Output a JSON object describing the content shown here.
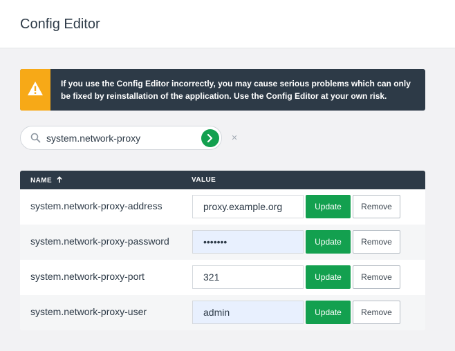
{
  "header": {
    "title": "Config Editor"
  },
  "warning": {
    "icon": "warning-icon",
    "accent_color": "#f7a917",
    "text": "If you use the Config Editor incorrectly, you may cause serious problems which can only be fixed by reinstallation of the application. Use the Config Editor at your own risk."
  },
  "search": {
    "value": "system.network-proxy",
    "go_icon": "chevron-right-icon",
    "clear_label": "×"
  },
  "table": {
    "columns": {
      "name": "NAME",
      "value": "VALUE"
    },
    "sort": {
      "column": "name",
      "direction": "ascending"
    },
    "rows": [
      {
        "name": "system.network-proxy-address",
        "value": "proxy.example.org",
        "autofilled": false,
        "update_label": "Update",
        "remove_label": "Remove"
      },
      {
        "name": "system.network-proxy-password",
        "value": "•••••••",
        "autofilled": true,
        "update_label": "Update",
        "remove_label": "Remove"
      },
      {
        "name": "system.network-proxy-port",
        "value": "321",
        "autofilled": false,
        "update_label": "Update",
        "remove_label": "Remove"
      },
      {
        "name": "system.network-proxy-user",
        "value": "admin",
        "autofilled": true,
        "update_label": "Update",
        "remove_label": "Remove"
      }
    ]
  },
  "colors": {
    "primary_button": "#13a04f",
    "header_dark": "#2d3a47",
    "autofill_bg": "#e8f0fe"
  }
}
